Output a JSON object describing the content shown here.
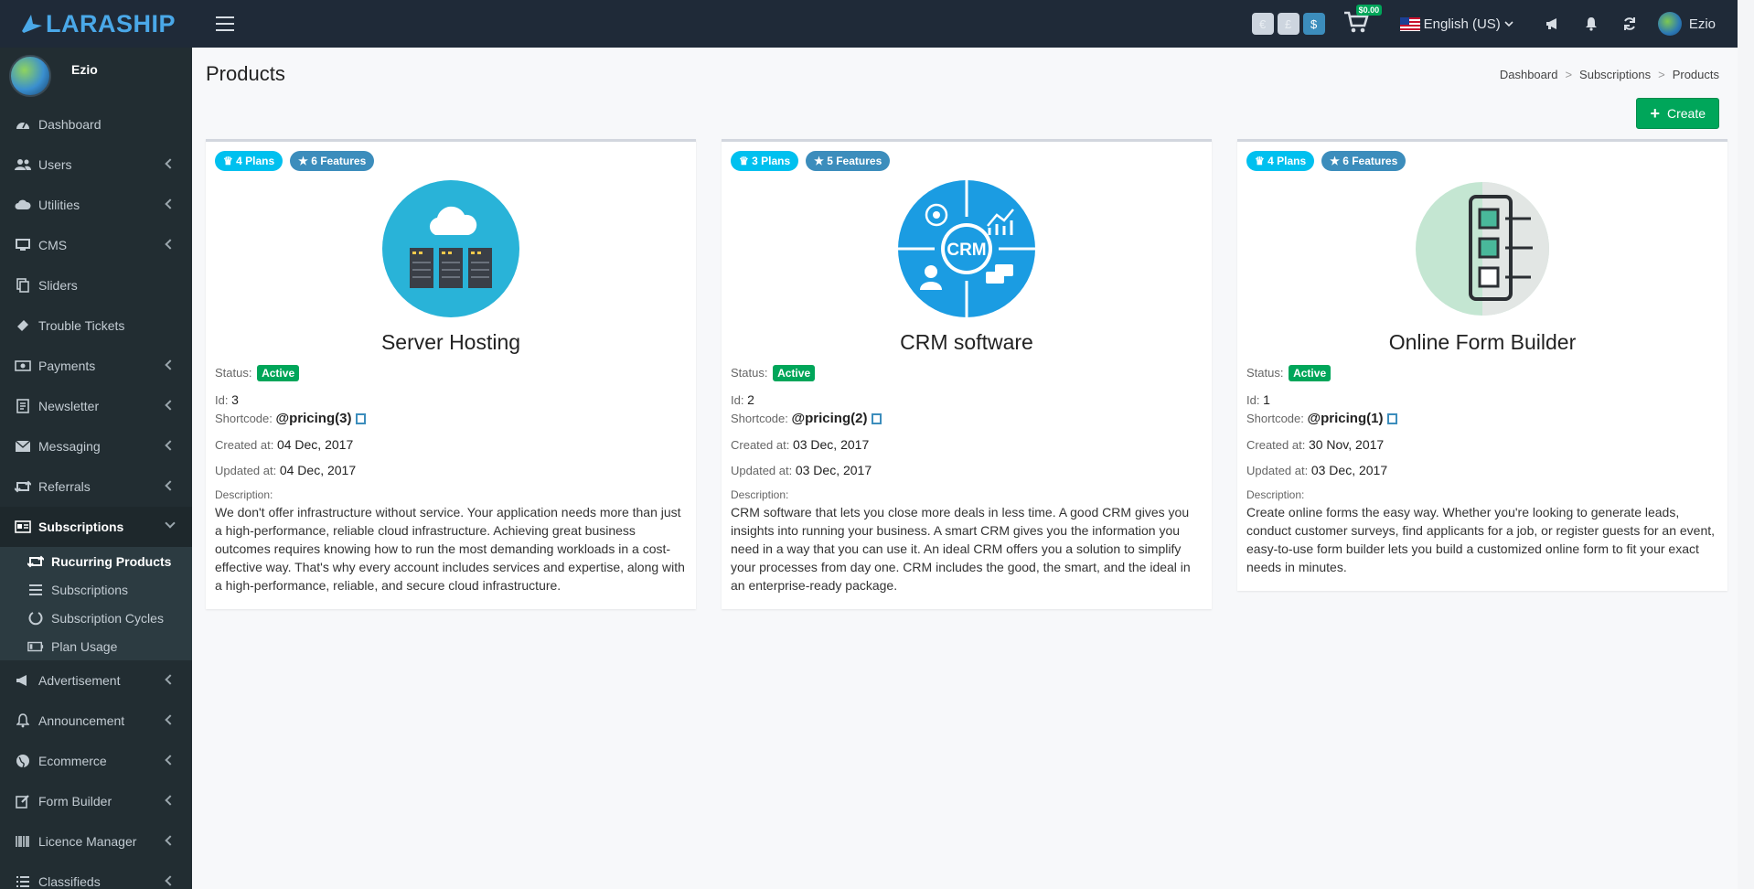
{
  "app": {
    "brand": "LARASHIP"
  },
  "topbar": {
    "currencies": [
      "€",
      "£",
      "$"
    ],
    "cart_amount": "$0.00",
    "language": "English (US)",
    "user_name": "Ezio"
  },
  "sidebar": {
    "user_name": "Ezio",
    "items": [
      {
        "label": "Dashboard",
        "icon": "dashboard-icon"
      },
      {
        "label": "Users",
        "icon": "users-icon"
      },
      {
        "label": "Utilities",
        "icon": "cloud-icon"
      },
      {
        "label": "CMS",
        "icon": "desktop-icon"
      },
      {
        "label": "Sliders",
        "icon": "copy-icon"
      },
      {
        "label": "Trouble Tickets",
        "icon": "ticket-icon"
      },
      {
        "label": "Payments",
        "icon": "money-icon"
      },
      {
        "label": "Newsletter",
        "icon": "newsletter-icon"
      },
      {
        "label": "Messaging",
        "icon": "envelope-icon"
      },
      {
        "label": "Referrals",
        "icon": "retweet-icon"
      },
      {
        "label": "Subscriptions",
        "icon": "subscriptions-icon"
      },
      {
        "label": "Advertisement",
        "icon": "bullhorn-icon"
      },
      {
        "label": "Announcement",
        "icon": "bell-icon"
      },
      {
        "label": "Ecommerce",
        "icon": "globe-icon"
      },
      {
        "label": "Form Builder",
        "icon": "edit-icon"
      },
      {
        "label": "Licence Manager",
        "icon": "barcode-icon"
      },
      {
        "label": "Classifieds",
        "icon": "list-icon"
      }
    ],
    "sub_items": [
      {
        "label": "Rucurring Products",
        "icon": "retweet-icon"
      },
      {
        "label": "Subscriptions",
        "icon": "bars-icon"
      },
      {
        "label": "Subscription Cycles",
        "icon": "circle-notch-icon"
      },
      {
        "label": "Plan Usage",
        "icon": "battery-icon"
      }
    ]
  },
  "page": {
    "title": "Products",
    "breadcrumb": [
      "Dashboard",
      "Subscriptions",
      "Products"
    ],
    "create_label": "Create",
    "labels": {
      "status": "Status:",
      "id": "Id:",
      "shortcode": "Shortcode:",
      "created": "Created at:",
      "updated": "Updated at:",
      "description": "Description:"
    }
  },
  "products": [
    {
      "plans": "4 Plans",
      "features": "6 Features",
      "name": "Server Hosting",
      "status": "Active",
      "id": "3",
      "shortcode": "@pricing(3)",
      "created": "04 Dec, 2017",
      "updated": "04 Dec, 2017",
      "description": "We don't offer infrastructure without service. Your application needs more than just a high-performance, reliable cloud infrastructure. Achieving great business outcomes requires knowing how to run the most demanding workloads in a cost-effective way. That's why every account includes services and expertise, along with a high-performance, reliable, and secure cloud infrastructure."
    },
    {
      "plans": "3 Plans",
      "features": "5 Features",
      "name": "CRM software",
      "status": "Active",
      "id": "2",
      "shortcode": "@pricing(2)",
      "created": "03 Dec, 2017",
      "updated": "03 Dec, 2017",
      "description": "CRM software that lets you close more deals in less time. A good CRM gives you insights into running your business. A smart CRM gives you the information you need in a way that you can use it. An ideal CRM offers you a solution to simplify your processes from day one. CRM includes the good, the smart, and the ideal in an enterprise-ready package.",
      "image_text": "CRM"
    },
    {
      "plans": "4 Plans",
      "features": "6 Features",
      "name": "Online Form Builder",
      "status": "Active",
      "id": "1",
      "shortcode": "@pricing(1)",
      "created": "30 Nov, 2017",
      "updated": "03 Dec, 2017",
      "description": "Create online forms the easy way. Whether you're looking to generate leads, conduct customer surveys, find applicants for a job, or register guests for an event, easy-to-use form builder lets you build a customized online form to fit your exact needs in minutes."
    }
  ],
  "colors": {
    "brand": "#4aa8e8",
    "success": "#00a65a",
    "info": "#00c0ef",
    "primary": "#3c8dbc",
    "sidebar": "#222d32",
    "topbar": "#1f2a38"
  }
}
